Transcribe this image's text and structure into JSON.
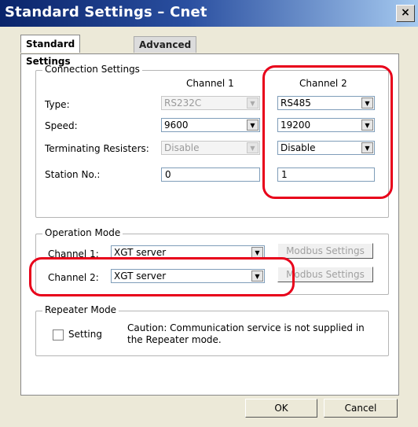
{
  "window": {
    "title": "Standard Settings – Cnet",
    "close_glyph": "×"
  },
  "tabs": [
    {
      "label": "Standard Settings",
      "active": true
    },
    {
      "label": "Advanced Settings",
      "active": false
    }
  ],
  "connection": {
    "group_title": "Connection Settings",
    "channel1_header": "Channel 1",
    "channel2_header": "Channel 2",
    "labels": {
      "type": "Type:",
      "speed": "Speed:",
      "terminating": "Terminating Resisters:",
      "station": "Station No.:"
    },
    "channel1": {
      "type": "RS232C",
      "speed": "9600",
      "terminating": "Disable",
      "station": "0"
    },
    "channel2": {
      "type": "RS485",
      "speed": "19200",
      "terminating": "Disable",
      "station": "1"
    }
  },
  "operation": {
    "group_title": "Operation Mode",
    "channel1_label": "Channel 1:",
    "channel1_value": "XGT server",
    "channel2_label": "Channel 2:",
    "channel2_value": "XGT server",
    "modbus_label": "Modbus Settings"
  },
  "repeater": {
    "group_title": "Repeater Mode",
    "setting_label": "Setting",
    "caution_line1": "Caution: Communication service is not supplied in",
    "caution_line2": "the Repeater mode."
  },
  "buttons": {
    "ok": "OK",
    "cancel": "Cancel"
  },
  "icons": {
    "dropdown_arrow": "▼"
  },
  "colors": {
    "highlight": "#e8001a",
    "title_bar": "#0a246a"
  }
}
